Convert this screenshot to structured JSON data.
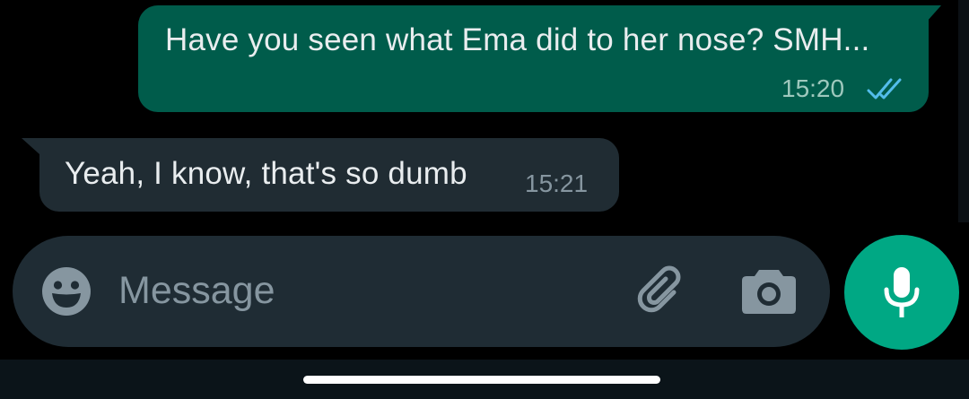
{
  "messages": [
    {
      "direction": "outgoing",
      "text": "Have you seen what Ema did to her nose? SMH...",
      "time": "15:20",
      "status": "read",
      "status_icon": "double-check-icon",
      "status_color": "#53bdeb"
    },
    {
      "direction": "incoming",
      "text": "Yeah, I know, that's so dumb",
      "time": "15:21"
    }
  ],
  "composer": {
    "placeholder": "Message",
    "emoji_icon": "emoji-icon",
    "attach_icon": "paperclip-icon",
    "camera_icon": "camera-icon",
    "mic_icon": "microphone-icon"
  },
  "colors": {
    "background": "#000000",
    "outgoing_bubble": "#005c4b",
    "incoming_bubble": "#202c33",
    "composer_bg": "#1f2c34",
    "accent": "#00a884",
    "placeholder": "#8696a0"
  }
}
